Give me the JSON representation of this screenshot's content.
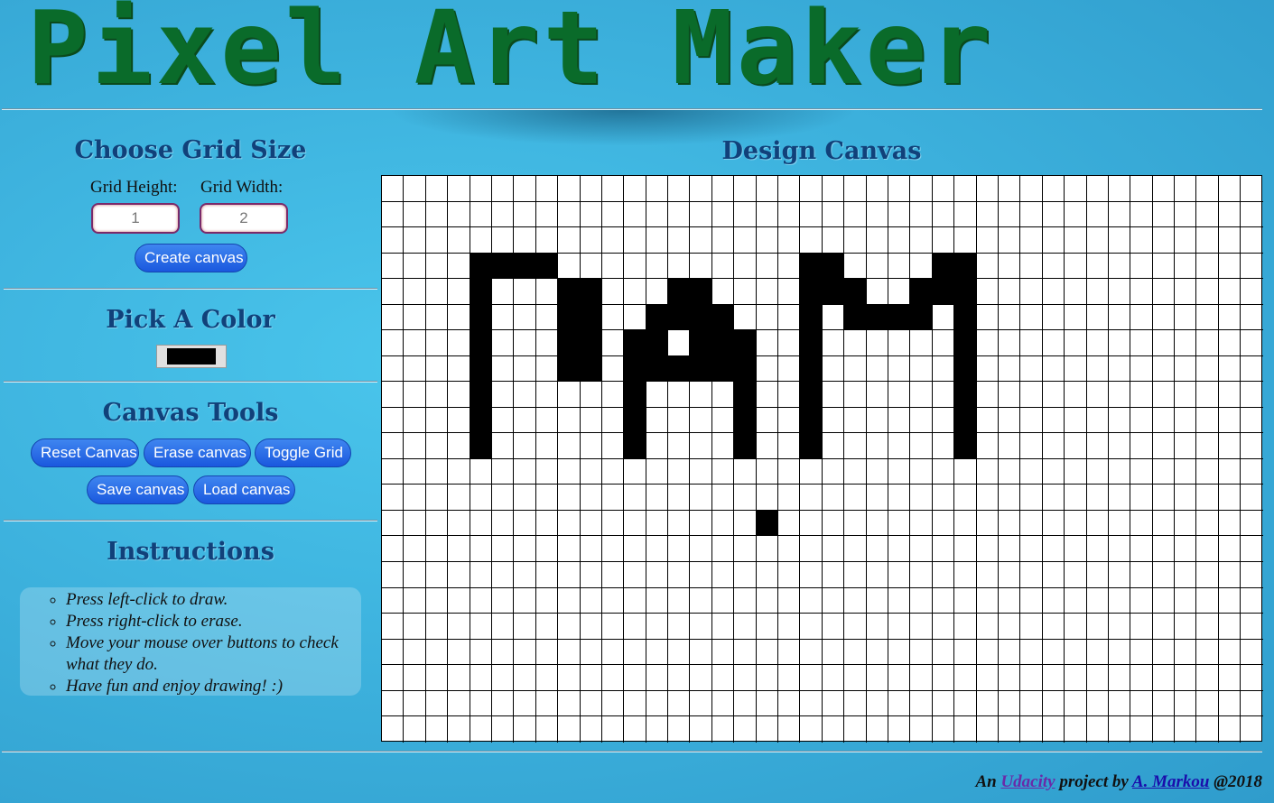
{
  "header": {
    "title": "Pixel Art Maker"
  },
  "sidebar": {
    "grid_size": {
      "heading": "Choose Grid Size",
      "height_label": "Grid Height:",
      "width_label": "Grid Width:",
      "height_value": "1",
      "width_value": "2",
      "create_label": "Create canvas"
    },
    "color": {
      "heading": "Pick A Color",
      "value": "#000000"
    },
    "tools": {
      "heading": "Canvas Tools",
      "reset": "Reset Canvas",
      "erase": "Erase canvas",
      "toggle": "Toggle Grid",
      "save": "Save canvas",
      "load": "Load canvas"
    },
    "instructions": {
      "heading": "Instructions",
      "items": [
        "Press left-click to draw.",
        "Press right-click to erase.",
        "Move your mouse over buttons to check what they do.",
        "Have fun and enjoy drawing! :)"
      ]
    }
  },
  "canvas": {
    "heading": "Design Canvas",
    "columns": 40,
    "rows": 22,
    "fill_color": "#000000",
    "filled_cells": [
      [
        3,
        4
      ],
      [
        3,
        5
      ],
      [
        3,
        6
      ],
      [
        3,
        7
      ],
      [
        4,
        4
      ],
      [
        5,
        4
      ],
      [
        6,
        4
      ],
      [
        7,
        4
      ],
      [
        8,
        4
      ],
      [
        9,
        4
      ],
      [
        10,
        4
      ],
      [
        4,
        8
      ],
      [
        4,
        9
      ],
      [
        5,
        8
      ],
      [
        5,
        9
      ],
      [
        6,
        8
      ],
      [
        6,
        9
      ],
      [
        7,
        8
      ],
      [
        7,
        9
      ],
      [
        4,
        13
      ],
      [
        4,
        14
      ],
      [
        5,
        12
      ],
      [
        5,
        13
      ],
      [
        5,
        14
      ],
      [
        5,
        15
      ],
      [
        6,
        11
      ],
      [
        6,
        12
      ],
      [
        6,
        14
      ],
      [
        6,
        15
      ],
      [
        6,
        16
      ],
      [
        7,
        11
      ],
      [
        7,
        12
      ],
      [
        7,
        13
      ],
      [
        7,
        14
      ],
      [
        7,
        15
      ],
      [
        7,
        16
      ],
      [
        8,
        11
      ],
      [
        8,
        16
      ],
      [
        9,
        11
      ],
      [
        9,
        16
      ],
      [
        10,
        11
      ],
      [
        10,
        16
      ],
      [
        3,
        19
      ],
      [
        3,
        20
      ],
      [
        4,
        19
      ],
      [
        4,
        20
      ],
      [
        4,
        21
      ],
      [
        5,
        19
      ],
      [
        5,
        21
      ],
      [
        5,
        22
      ],
      [
        6,
        19
      ],
      [
        7,
        19
      ],
      [
        8,
        19
      ],
      [
        9,
        19
      ],
      [
        10,
        19
      ],
      [
        3,
        25
      ],
      [
        3,
        26
      ],
      [
        4,
        24
      ],
      [
        4,
        25
      ],
      [
        4,
        26
      ],
      [
        5,
        23
      ],
      [
        5,
        24
      ],
      [
        5,
        26
      ],
      [
        6,
        26
      ],
      [
        7,
        26
      ],
      [
        8,
        26
      ],
      [
        9,
        26
      ],
      [
        10,
        26
      ],
      [
        13,
        17
      ]
    ]
  },
  "footer": {
    "prefix": "An",
    "link1": "Udacity",
    "middle": "project by",
    "link2": "A. Markou",
    "suffix": "@2018"
  }
}
